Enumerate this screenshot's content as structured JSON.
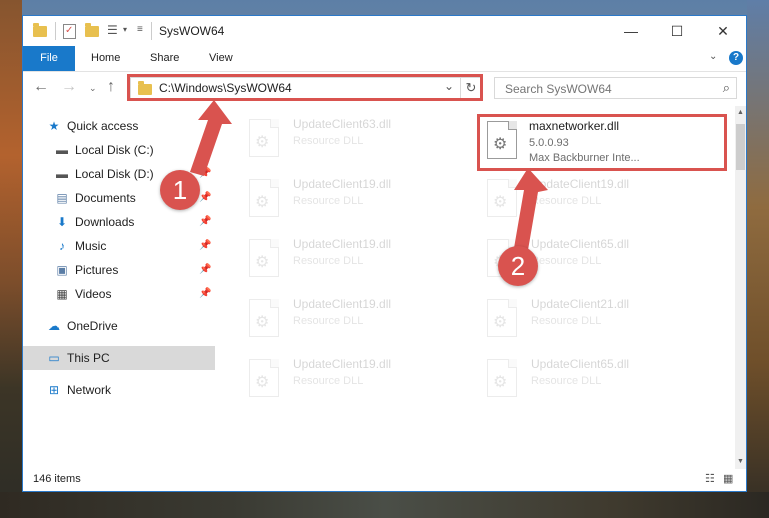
{
  "window": {
    "title": "SysWOW64",
    "controls": {
      "minimize": "—",
      "maximize": "☐",
      "close": "✕"
    }
  },
  "ribbon": {
    "file_tab": "File",
    "tabs": [
      "Home",
      "Share",
      "View"
    ],
    "help": "?"
  },
  "navigation": {
    "address": "C:\\Windows\\SysWOW64",
    "search_placeholder": "Search SysWOW64"
  },
  "sidebar": {
    "items": [
      {
        "label": "Quick access",
        "icon": "star-icon",
        "pinned": false
      },
      {
        "label": "Local Disk (C:)",
        "icon": "drive-icon",
        "pinned": true
      },
      {
        "label": "Local Disk (D:)",
        "icon": "drive-icon",
        "pinned": true
      },
      {
        "label": "Documents",
        "icon": "documents-icon",
        "pinned": true
      },
      {
        "label": "Downloads",
        "icon": "download-icon",
        "pinned": true
      },
      {
        "label": "Music",
        "icon": "music-icon",
        "pinned": true
      },
      {
        "label": "Pictures",
        "icon": "pictures-icon",
        "pinned": true
      },
      {
        "label": "Videos",
        "icon": "videos-icon",
        "pinned": true
      },
      {
        "label": "OneDrive",
        "icon": "cloud-icon",
        "pinned": false
      },
      {
        "label": "This PC",
        "icon": "computer-icon",
        "pinned": false,
        "selected": true
      },
      {
        "label": "Network",
        "icon": "network-icon",
        "pinned": false
      }
    ]
  },
  "files": {
    "left": [
      {
        "name": "UpdateClient63.dll",
        "type": "Resource DLL"
      },
      {
        "name": "UpdateClient19.dll",
        "type": "Resource DLL"
      },
      {
        "name": "UpdateClient19.dll",
        "type": "Resource DLL"
      },
      {
        "name": "UpdateClient19.dll",
        "type": "Resource DLL"
      },
      {
        "name": "UpdateClient19.dll",
        "type": "Resource DLL"
      }
    ],
    "right": [
      {
        "name": "maxnetworker.dll",
        "version": "5.0.0.93",
        "company": "Max Backburner Inte...",
        "active": true
      },
      {
        "name": "UpdateClient19.dll",
        "type": "Resource DLL"
      },
      {
        "name": "UpdateClient65.dll",
        "type": "Resource DLL"
      },
      {
        "name": "UpdateClient21.dll",
        "type": "Resource DLL"
      },
      {
        "name": "UpdateClient65.dll",
        "type": "Resource DLL"
      }
    ]
  },
  "status": {
    "items": "146 items"
  },
  "annotations": {
    "marker1": "1",
    "marker2": "2",
    "color": "#d9534f"
  }
}
